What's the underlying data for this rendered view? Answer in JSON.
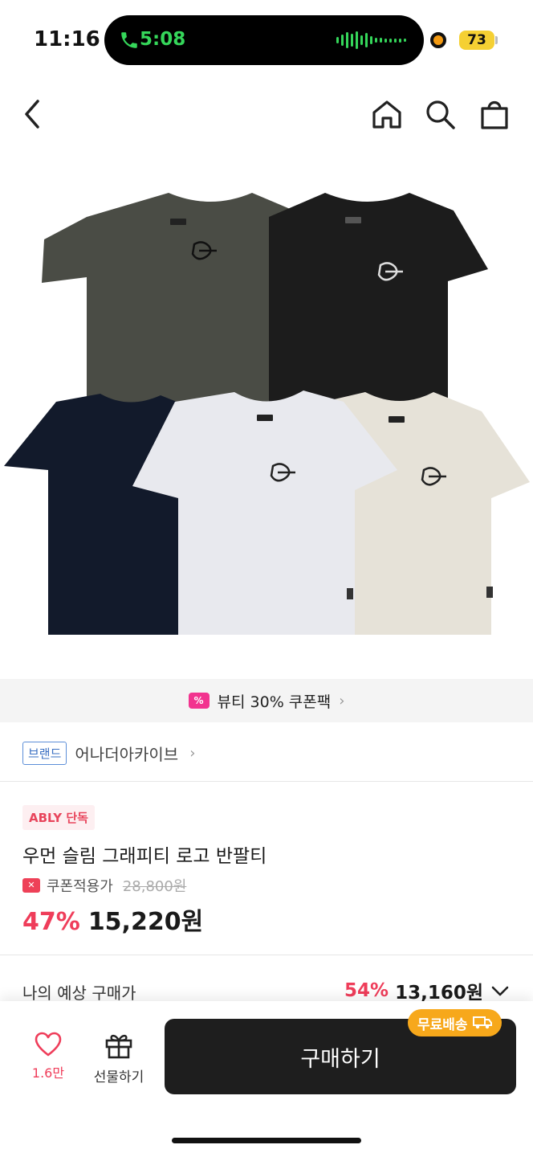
{
  "status": {
    "time": "11:16",
    "call_time": "5:08",
    "battery": "73"
  },
  "nav": {
    "back": "back",
    "home": "home",
    "search": "search",
    "cart": "cart"
  },
  "coupon_banner": {
    "icon": "%",
    "text": "뷰티 30% 쿠폰팩",
    "chevron": "›"
  },
  "brand": {
    "tag": "브랜드",
    "name": "어나더아카이브",
    "chevron": "›"
  },
  "product": {
    "badge": "ABLY 단독",
    "title": "우먼 슬림 그래피티 로고 반팔티",
    "coupon_label": "쿠폰적용가",
    "original_price": "28,800원",
    "discount": "47%",
    "price": "15,220원"
  },
  "estimate": {
    "label": "나의 예상 구매가",
    "discount": "54%",
    "price": "13,160원"
  },
  "bottom": {
    "like_count": "1.6만",
    "gift_label": "선물하기",
    "buy_label": "구매하기",
    "free_shipping": "무료배송"
  },
  "colors": {
    "accent_red": "#ef3d5a",
    "coupon_pink": "#f2338f",
    "shipping_orange": "#f7a81b",
    "buy_button": "#1e1e1e"
  }
}
